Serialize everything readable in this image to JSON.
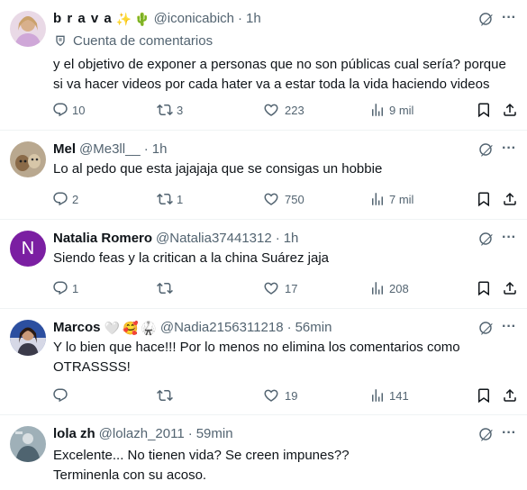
{
  "replies": [
    {
      "name": "b r a v a",
      "emojis": [
        "✨",
        "🌵"
      ],
      "handle": "@iconicabich",
      "time": "1h",
      "community": "Cuenta de comentarios",
      "text_lines": [
        "y el objetivo de exponer a personas que no son públicas cual sería? porque",
        "si va hacer videos por cada hater va a estar toda la vida haciendo videos"
      ],
      "replies": "10",
      "reposts": "3",
      "likes": "223",
      "views": "9 mil"
    },
    {
      "name": "Mel",
      "handle": "@Me3ll__",
      "time": "1h",
      "text_lines": [
        "Lo al pedo que esta jajajaja que se consigas un hobbie"
      ],
      "replies": "2",
      "reposts": "1",
      "likes": "750",
      "views": "7 mil"
    },
    {
      "name": "Natalia Romero",
      "handle": "@Natalia37441312",
      "time": "1h",
      "avatar_letter": "N",
      "text_lines": [
        "Siendo feas y la critican a la china Suárez jaja"
      ],
      "replies": "1",
      "reposts": "",
      "likes": "17",
      "views": "208"
    },
    {
      "name": "Marcos",
      "emojis": [
        "🤍",
        "🥰",
        "🥋"
      ],
      "handle": "@Nadia2156311218",
      "time": "56min",
      "text_lines": [
        "Y lo bien que hace!!! Por lo menos no elimina los comentarios como",
        "OTRASSSS!"
      ],
      "replies": "",
      "reposts": "",
      "likes": "19",
      "views": "141"
    },
    {
      "name": "lola zh",
      "handle": "@lolazh_2011",
      "time": "59min",
      "text_lines": [
        "Excelente... No tienen vida? Se creen impunes??",
        "Terminenla con su acoso."
      ]
    }
  ],
  "dot": "·",
  "more_glyph": "···",
  "colors": {
    "text": "#0f1419",
    "muted": "#536471",
    "divider": "#eff3f4",
    "natalia_avatar": "#7b1fa2"
  }
}
